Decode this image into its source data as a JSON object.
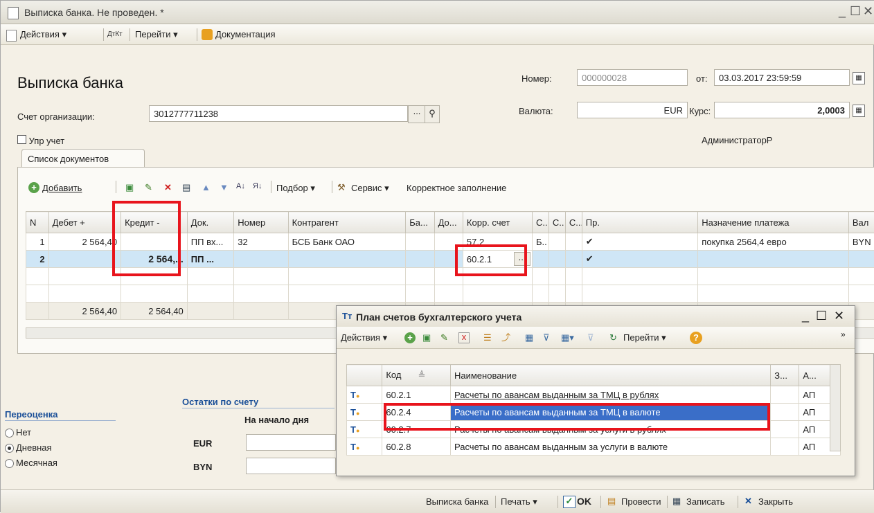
{
  "window": {
    "title": "Выписка банка. Не проведен. *"
  },
  "menu": {
    "actions": "Действия ▾",
    "goto": "Перейти ▾",
    "docs": "Документация"
  },
  "form": {
    "heading": "Выписка банка",
    "number_label": "Номер:",
    "number_value": "000000028",
    "date_label": "от:",
    "date_value": "03.03.2017 23:59:59",
    "account_label": "Счет организации:",
    "account_value": "3012777711238",
    "currency_label": "Валюта:",
    "currency_value": "EUR",
    "rate_label": "Курс:",
    "rate_value": "2,0003",
    "upr_label": "Упр учет",
    "user": "АдминистраторР"
  },
  "tab": {
    "label": "Список документов"
  },
  "toolbar": {
    "add": "Добавить",
    "select": "Подбор ▾",
    "service": "Сервис ▾",
    "correct": "Корректное заполнение"
  },
  "grid": {
    "headers": [
      "N",
      "Дебет +",
      "Кредит -",
      "Док.",
      "Номер",
      "Контрагент",
      "Ба...",
      "До...",
      "Корр. счет",
      "С..",
      "С..",
      "С...",
      "Пр.",
      "Назначение платежа",
      "Вал"
    ],
    "rows": [
      [
        "1",
        "2 564,40",
        "",
        "ПП вх...",
        "32",
        "БСБ Банк ОАО",
        "",
        "",
        "57.2",
        "Б..",
        "",
        "",
        "✔",
        "покупка 2564,4 евро",
        "BYN"
      ],
      [
        "2",
        "",
        "2 564,...",
        "ПП ...",
        "",
        "",
        "",
        "",
        "60.2.1",
        "",
        "",
        "",
        "✔",
        "",
        ""
      ]
    ],
    "totals": [
      "",
      "2 564,40",
      "2 564,40"
    ]
  },
  "reval": {
    "title": "Переоценка",
    "options": [
      "Нет",
      "Дневная",
      "Месячная"
    ],
    "selected": "Дневная"
  },
  "balances": {
    "title": "Остатки по счету",
    "col": "На начало дня",
    "rows": [
      "EUR",
      "BYN"
    ]
  },
  "popup": {
    "title": "План счетов бухгалтерского учета",
    "actions": "Действия ▾",
    "goto": "Перейти ▾",
    "headers": [
      "",
      "Код",
      "Наименование",
      "З...",
      "А..."
    ],
    "rows": [
      [
        "60.2.1",
        "Расчеты по авансам выданным за ТМЦ в рублях",
        "АП"
      ],
      [
        "60.2.4",
        "Расчеты по авансам выданным за ТМЦ в валюте",
        "АП"
      ],
      [
        "60.2.7",
        "Расчеты по авансам выданным за услуги в рублях",
        "АП"
      ],
      [
        "60.2.8",
        "Расчеты по авансам выданным за услуги в валюте",
        "АП"
      ]
    ]
  },
  "bottom": {
    "bank": "Выписка банка",
    "print": "Печать ▾",
    "ok": "OK",
    "post": "Провести",
    "save": "Записать",
    "close": "Закрыть"
  }
}
